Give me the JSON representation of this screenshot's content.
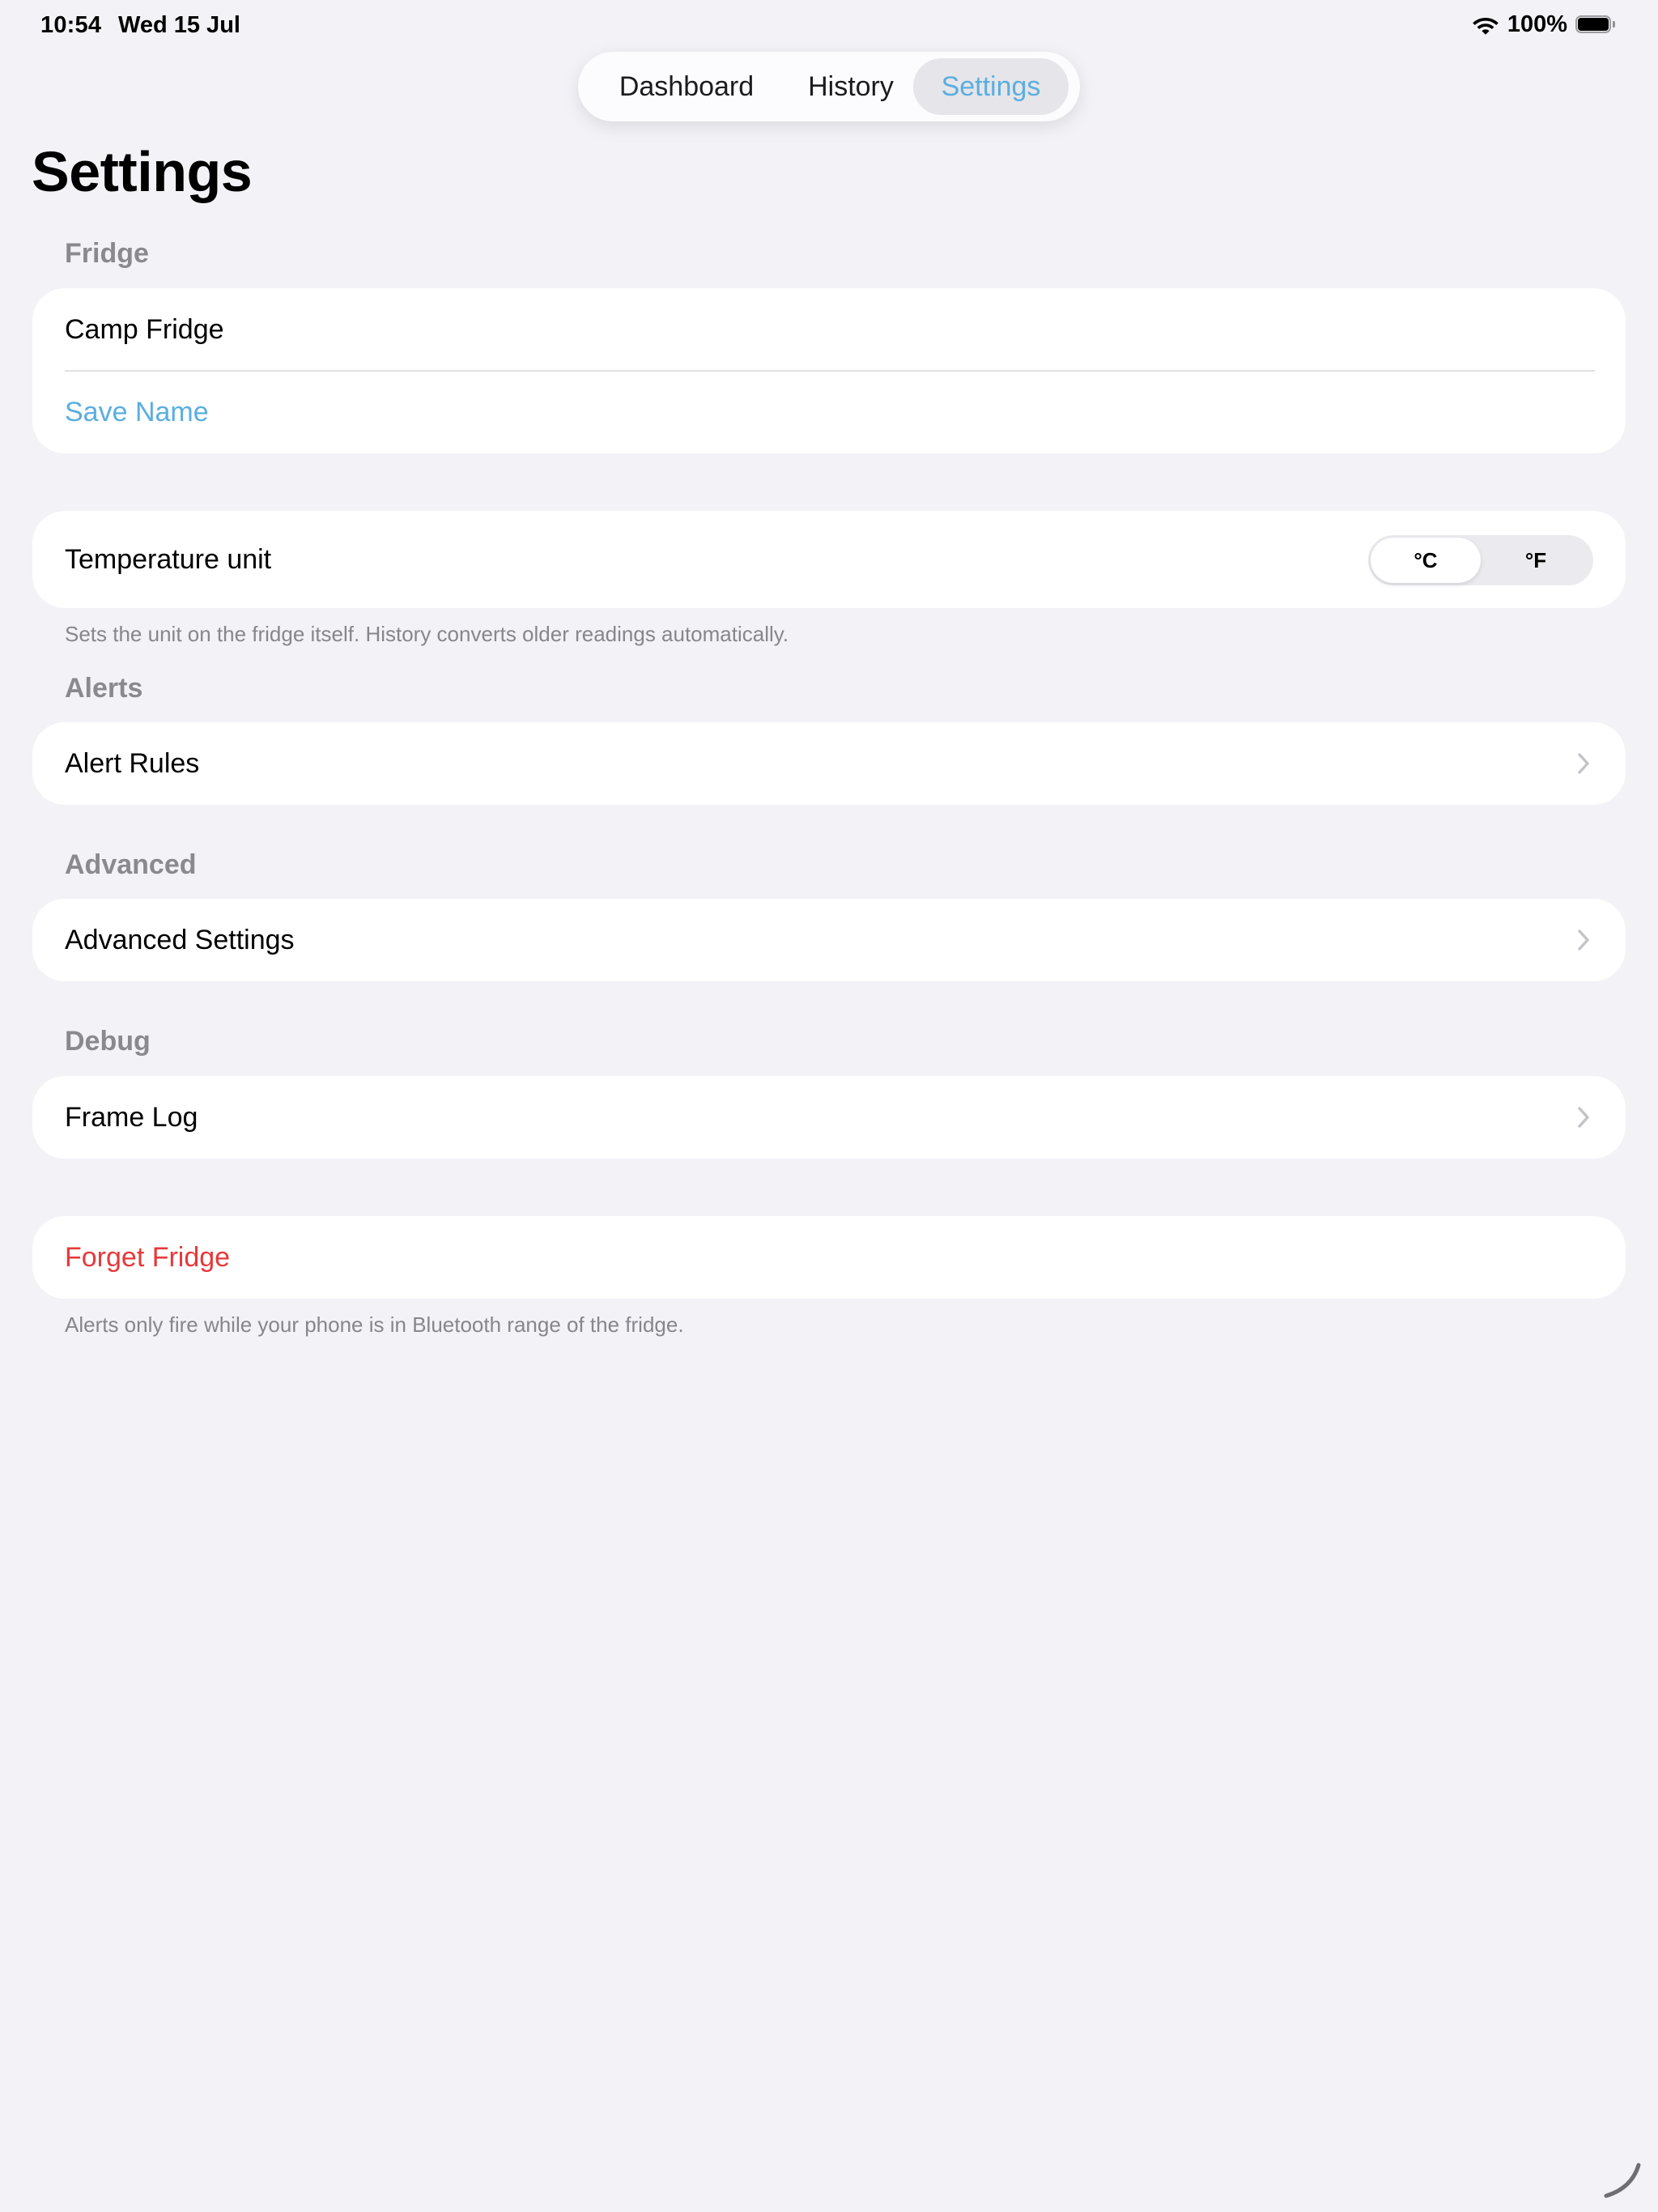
{
  "status_bar": {
    "time": "10:54",
    "date": "Wed 15 Jul",
    "battery_percent": "100%",
    "battery_level": 1.0
  },
  "tabs": [
    {
      "label": "Dashboard",
      "active": false
    },
    {
      "label": "History",
      "active": false
    },
    {
      "label": "Settings",
      "active": true
    }
  ],
  "page_title": "Settings",
  "fridge_section": {
    "header": "Fridge",
    "name_value": "Camp Fridge",
    "save_label": "Save Name"
  },
  "temperature": {
    "label": "Temperature unit",
    "options": [
      "°C",
      "°F"
    ],
    "selected": "°C",
    "footnote": "Sets the unit on the fridge itself. History converts older readings automatically."
  },
  "alerts_section": {
    "header": "Alerts",
    "item": "Alert Rules"
  },
  "advanced_section": {
    "header": "Advanced",
    "item": "Advanced Settings"
  },
  "debug_section": {
    "header": "Debug",
    "item": "Frame Log"
  },
  "forget": {
    "label": "Forget Fridge",
    "footnote": "Alerts only fire while your phone is in Bluetooth range of the fridge."
  },
  "colors": {
    "accent": "#5aaee0",
    "destructive": "#e5393b",
    "background": "#f2f2f7",
    "secondary_text": "#8a8a8e"
  }
}
